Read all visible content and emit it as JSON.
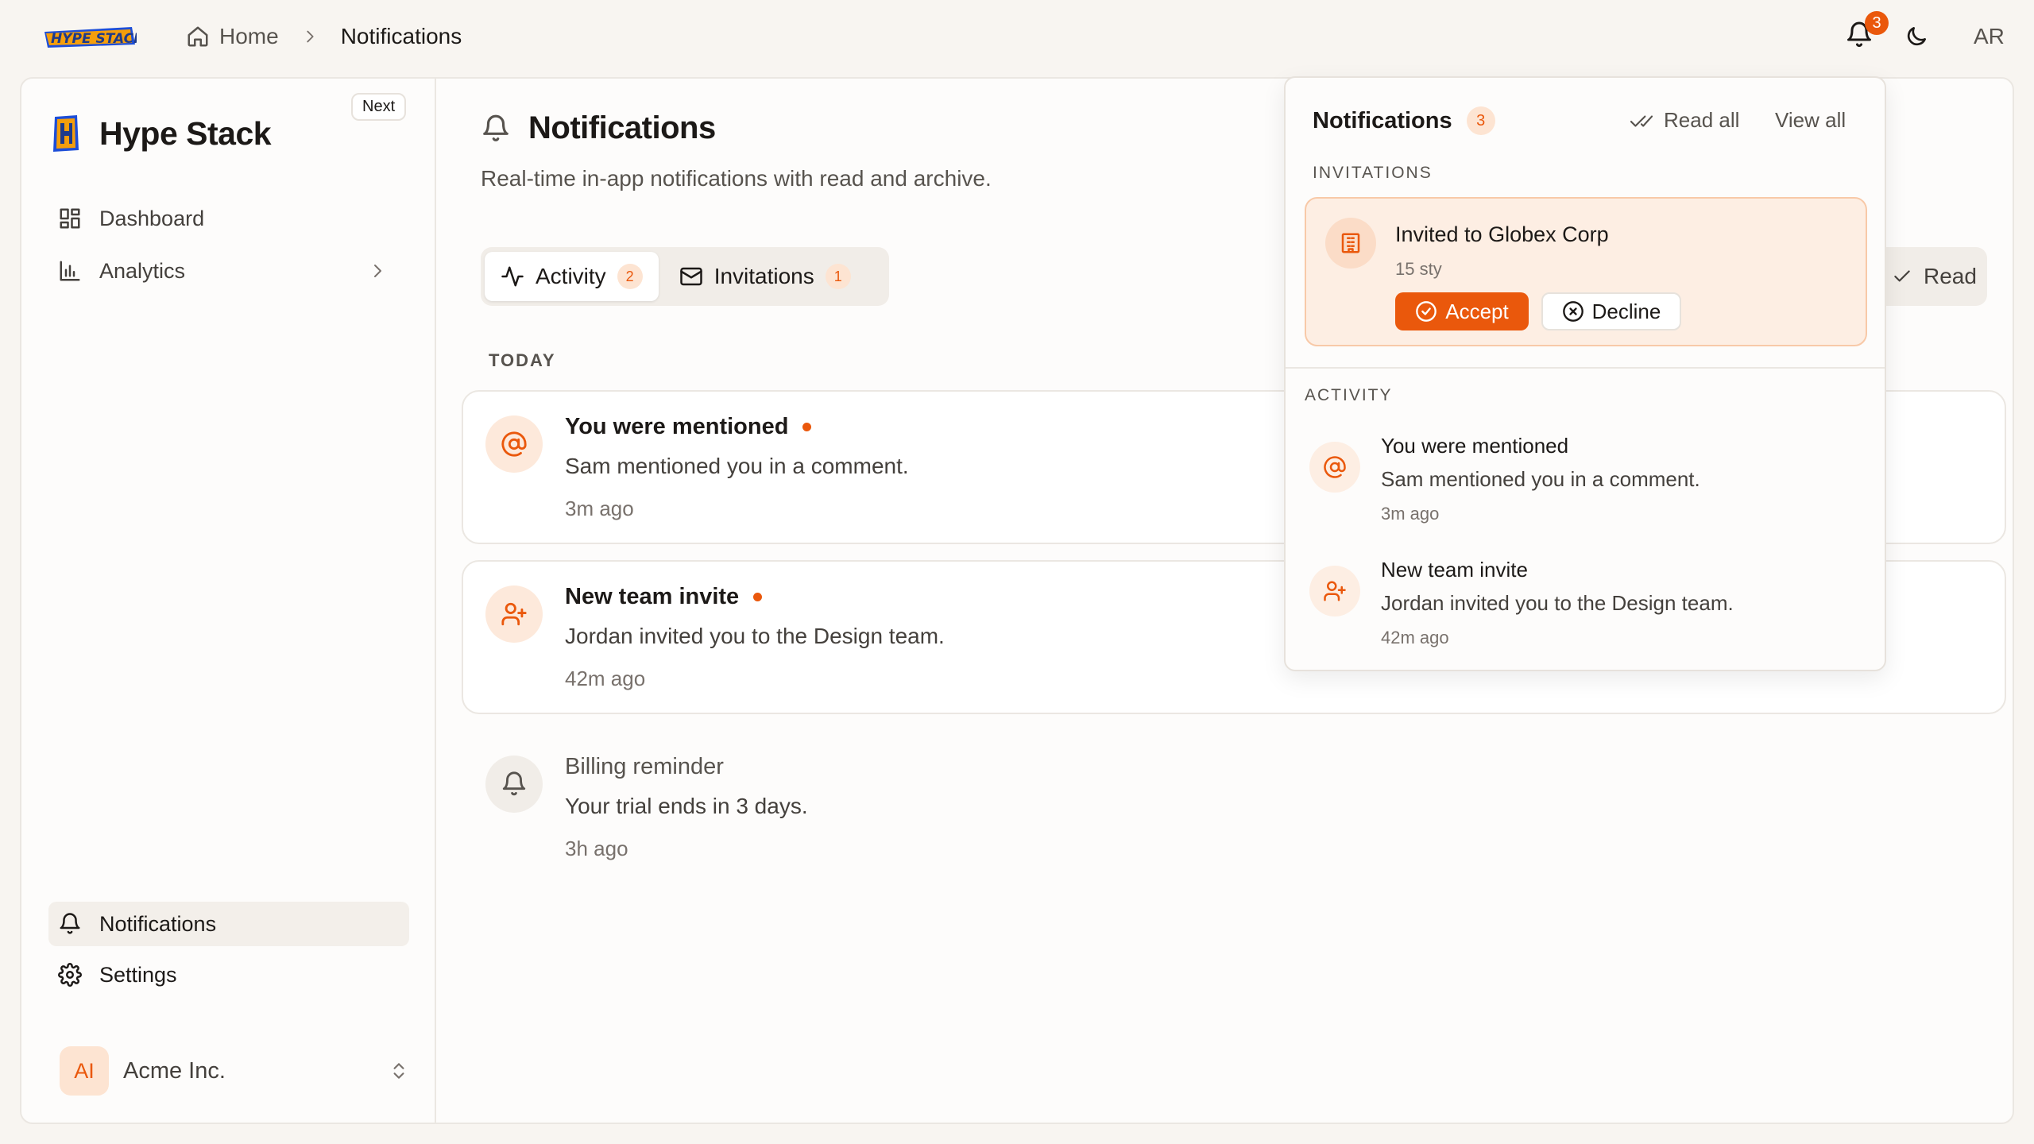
{
  "brand": {
    "logo_text": "HYPE STACK",
    "app_name": "Hype Stack",
    "next_badge": "Next"
  },
  "breadcrumb": {
    "home": "Home",
    "current": "Notifications"
  },
  "topbar": {
    "bell_count": "3",
    "user_initials": "AR"
  },
  "sidebar": {
    "items": [
      {
        "label": "Dashboard",
        "icon": "dashboard-icon"
      },
      {
        "label": "Analytics",
        "icon": "bar-chart-icon"
      },
      {
        "label": "Notifications",
        "icon": "bell-icon"
      },
      {
        "label": "Settings",
        "icon": "gear-icon"
      }
    ],
    "org": {
      "initials": "AI",
      "name": "Acme Inc."
    }
  },
  "page": {
    "title": "Notifications",
    "subtitle": "Real-time in-app notifications with read and archive.",
    "tabs": [
      {
        "label": "Activity",
        "count": "2"
      },
      {
        "label": "Invitations",
        "count": "1"
      }
    ],
    "read_button": "Read",
    "section_today": "TODAY",
    "notifications": [
      {
        "title": "You were mentioned",
        "body": "Sam mentioned you in a comment.",
        "time": "3m ago",
        "unread": true
      },
      {
        "title": "New team invite",
        "body": "Jordan invited you to the Design team.",
        "time": "42m ago",
        "unread": true
      },
      {
        "title": "Billing reminder",
        "body": "Your trial ends in 3 days.",
        "time": "3h ago",
        "unread": false
      }
    ]
  },
  "popover": {
    "title": "Notifications",
    "count": "3",
    "read_all": "Read all",
    "view_all": "View all",
    "section_invitations": "INVITATIONS",
    "invitation": {
      "title": "Invited to Globex Corp",
      "meta": "15 sty",
      "accept": "Accept",
      "decline": "Decline"
    },
    "section_activity": "ACTIVITY",
    "activity": [
      {
        "title": "You were mentioned",
        "body": "Sam mentioned you in a comment.",
        "time": "3m ago"
      },
      {
        "title": "New team invite",
        "body": "Jordan invited you to the Design team.",
        "time": "42m ago"
      }
    ]
  },
  "colors": {
    "accent": "#ea580c",
    "accent_soft": "#fde4d2",
    "background": "#f8f5f1"
  }
}
